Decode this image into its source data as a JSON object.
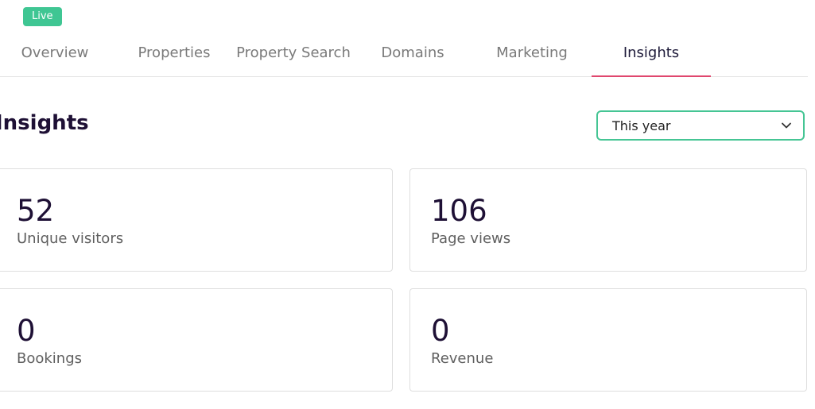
{
  "status": {
    "badge": "Live"
  },
  "tabs": [
    {
      "label": "Overview",
      "active": false
    },
    {
      "label": "Properties",
      "active": false
    },
    {
      "label": "Property Search",
      "active": false
    },
    {
      "label": "Domains",
      "active": false
    },
    {
      "label": "Marketing",
      "active": false
    },
    {
      "label": "Insights",
      "active": true
    }
  ],
  "main": {
    "title": "Insights",
    "period": {
      "selected": "This year",
      "icon": "chevron-down-icon"
    }
  },
  "stats": [
    {
      "value": "52",
      "label": "Unique visitors"
    },
    {
      "value": "106",
      "label": "Page views"
    },
    {
      "value": "0",
      "label": "Bookings"
    },
    {
      "value": "0",
      "label": "Revenue"
    }
  ],
  "colors": {
    "live_badge": "#3fc693",
    "active_tab_underline": "#e0476e",
    "select_border": "#45c594",
    "heading": "#1e1035"
  }
}
